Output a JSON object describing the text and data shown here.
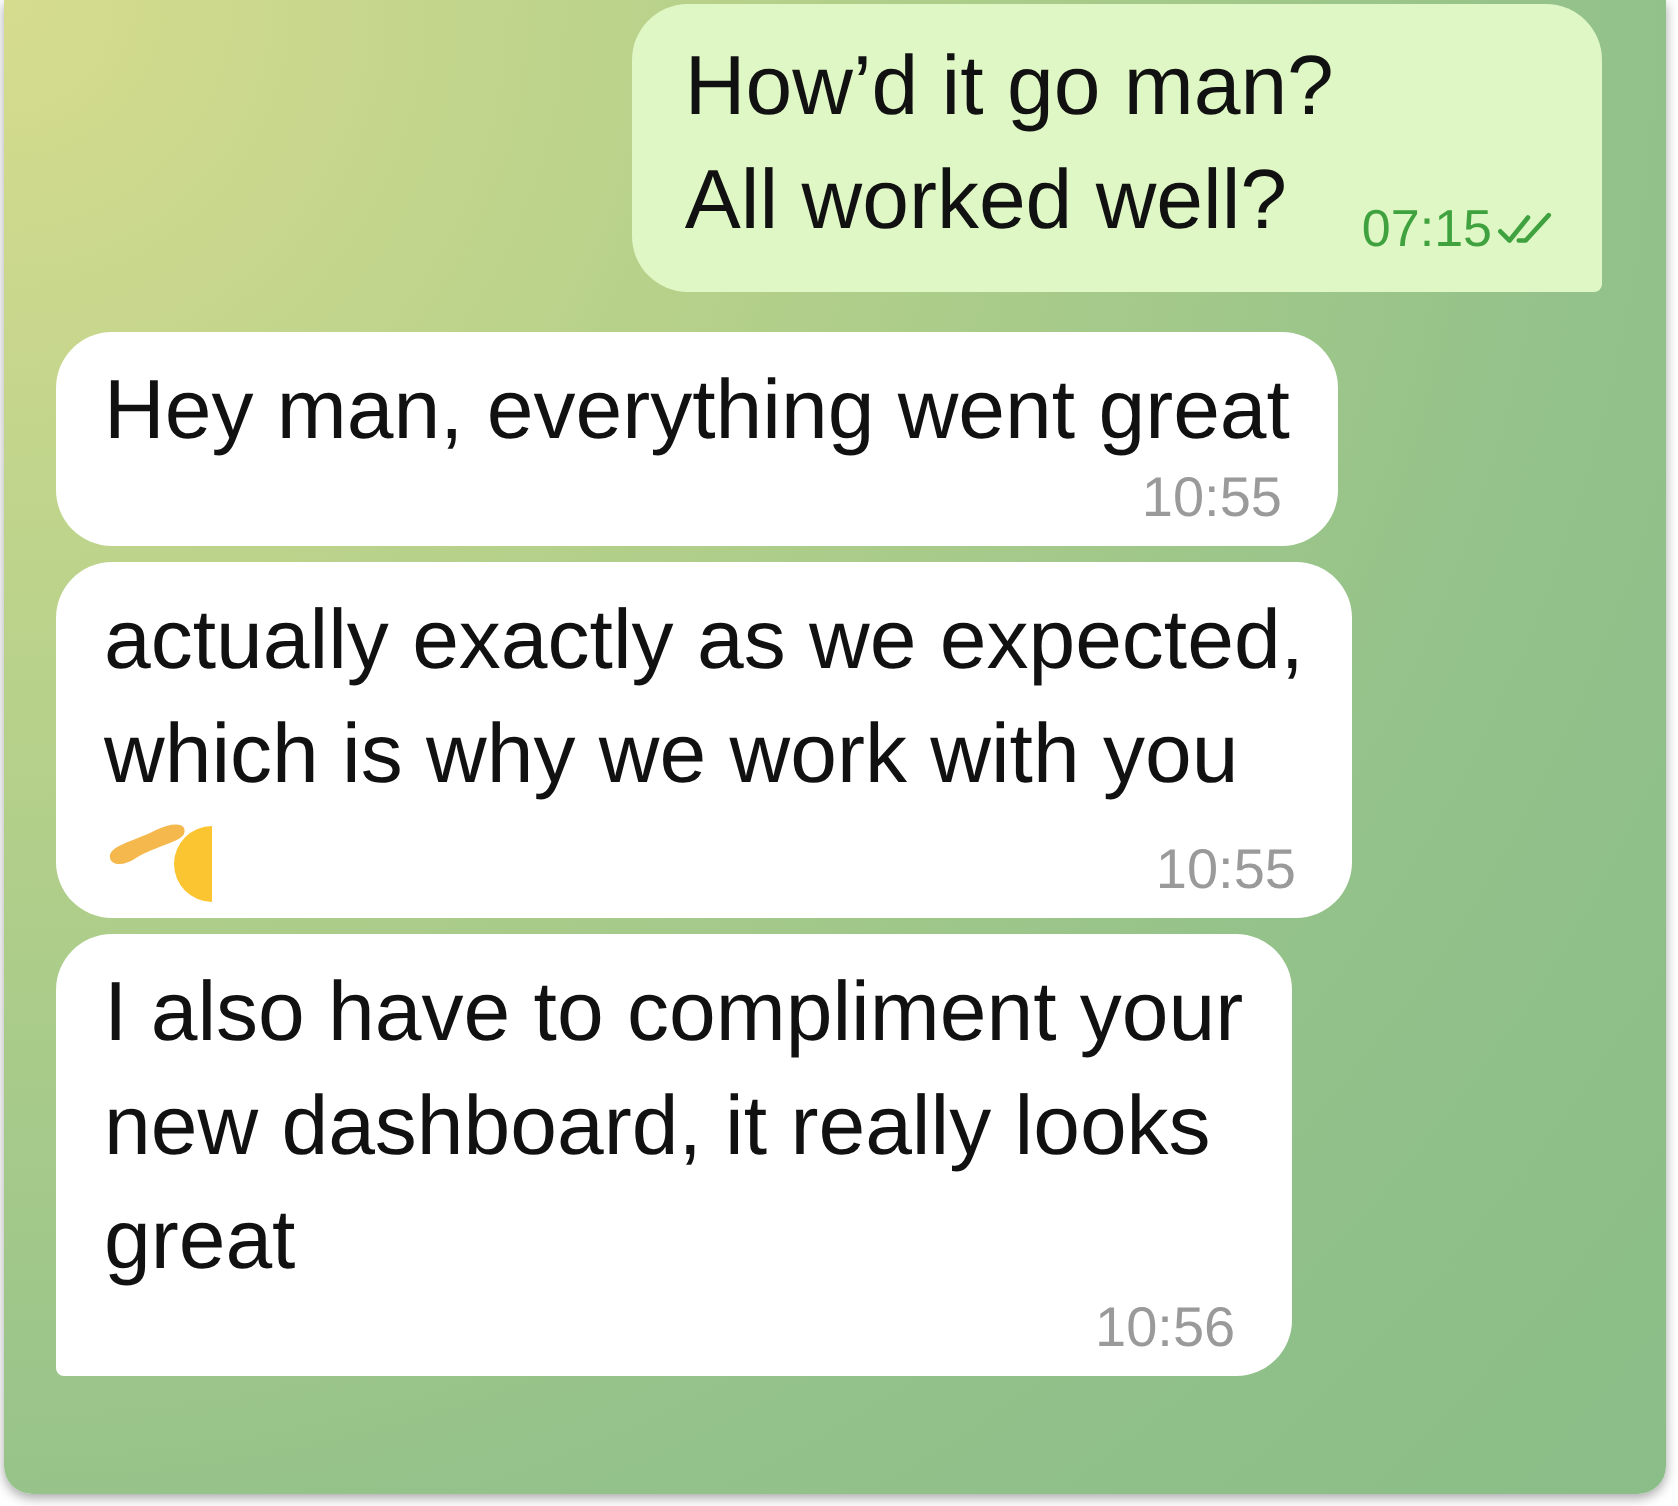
{
  "messages": [
    {
      "kind": "outgoing",
      "text": "How’d it go man?\nAll worked well?",
      "time": "07:15",
      "read": true,
      "tail": true,
      "salute_emoji": false
    },
    {
      "kind": "incoming",
      "text": "Hey man, everything went great",
      "time": "10:55",
      "tail": false,
      "salute_emoji": false
    },
    {
      "kind": "incoming",
      "text": "actually exactly as we expected,\nwhich is why we work with you",
      "time": "10:55",
      "tail": false,
      "salute_emoji": true
    },
    {
      "kind": "incoming",
      "text": "I also have to compliment your\nnew dashboard, it really looks\ngreat",
      "time": "10:56",
      "tail": true,
      "salute_emoji": false
    }
  ]
}
